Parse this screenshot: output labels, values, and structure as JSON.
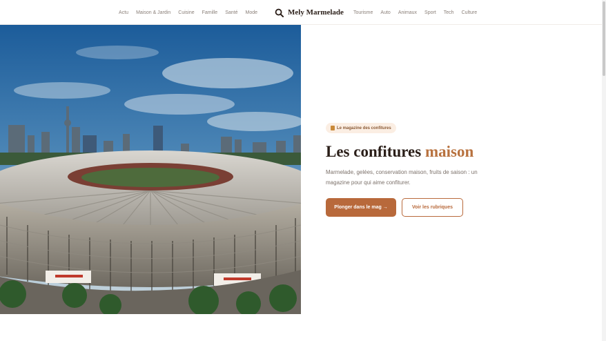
{
  "header": {
    "nav_left": [
      "Actu",
      "Maison & Jardin",
      "Cuisine",
      "Famille",
      "Santé",
      "Mode"
    ],
    "brand": "Mely Marmelade",
    "nav_right": [
      "Tourisme",
      "Auto",
      "Animaux",
      "Sport",
      "Tech",
      "Culture"
    ]
  },
  "hero": {
    "badge": "Le magazine des confitures",
    "title_main": "Les confitures ",
    "title_accent": "maison",
    "subtitle": "Marmelade, gelées, conservation maison, fruits de saison : un magazine pour qui aime confiturer.",
    "primary_button": "Plonger dans le mag →",
    "secondary_button": "Voir les rubriques"
  },
  "colors": {
    "accent": "#b8723f",
    "button": "#b8693b",
    "badge_bg": "#fbeee3",
    "title": "#2a1e18"
  },
  "icons": {
    "brand": "search-icon",
    "badge": "jar-icon"
  }
}
